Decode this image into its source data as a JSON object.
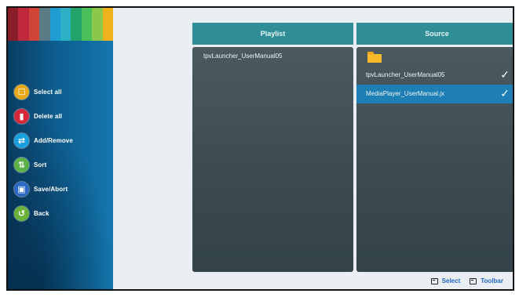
{
  "colors": {
    "header_bg": "#2e8d95",
    "selected_bg": "#1d7fb3",
    "sidebar_bg": "#0d5d8f",
    "accent_link": "#1f67c2",
    "stripes": [
      "#8a1d2a",
      "#c0283b",
      "#d0453a",
      "#5a7a86",
      "#1e9ed0",
      "#2cb1c4",
      "#23a36a",
      "#4bc05a",
      "#8cc64b",
      "#f0b21b"
    ]
  },
  "sidebar": {
    "items": [
      {
        "label": "Select all",
        "icon": "select-all-icon",
        "color": "#e7a91a",
        "glyph": "☐"
      },
      {
        "label": "Delete all",
        "icon": "trash-icon",
        "color": "#d7283a",
        "glyph": "▮"
      },
      {
        "label": "Add/Remove",
        "icon": "swap-icon",
        "color": "#1aa0df",
        "glyph": "⇄"
      },
      {
        "label": "Sort",
        "icon": "sort-icon",
        "color": "#5bb148",
        "glyph": "⇅"
      },
      {
        "label": "Save/Abort",
        "icon": "save-icon",
        "color": "#2c68c6",
        "glyph": "▣"
      },
      {
        "label": "Back",
        "icon": "back-icon",
        "color": "#6ab23a",
        "glyph": "↺"
      }
    ]
  },
  "playlist": {
    "header": "Playlist",
    "items": [
      "tpvLauncher_UserManual05"
    ]
  },
  "source": {
    "header": "Source",
    "items": [
      {
        "label": "tpvLauncher_UserManual05",
        "checked": true,
        "selected": false
      },
      {
        "label": "MediaPlayer_UserManual.jx",
        "checked": true,
        "selected": true
      }
    ]
  },
  "footer": {
    "select_label": "Select",
    "toolbar_label": "Toolbar"
  }
}
